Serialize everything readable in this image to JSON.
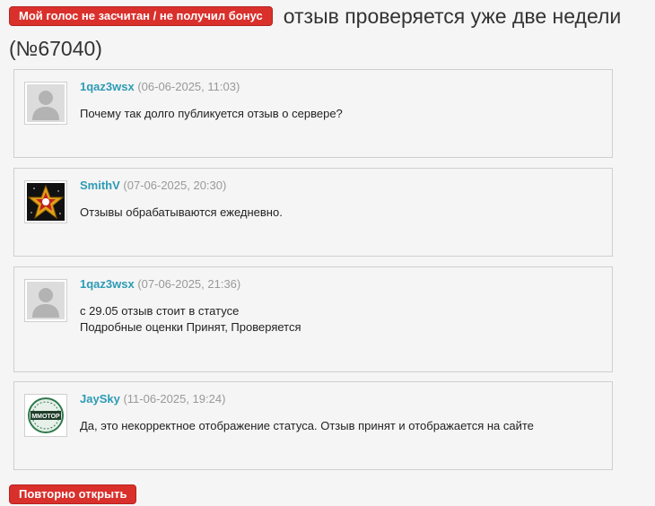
{
  "header": {
    "badge_label": "Мой голос не засчитан / не получил бонус",
    "title": "отзыв проверяется уже две недели (№67040)"
  },
  "messages": [
    {
      "author": "1qaz3wsx",
      "date": "(06-06-2025, 11:03)",
      "avatar_icon": "default-user-avatar-icon",
      "lines": [
        "Почему так долго публикуется отзыв о сервере?"
      ]
    },
    {
      "author": "SmithV",
      "date": "(07-06-2025, 20:30)",
      "avatar_icon": "gold-star-avatar-icon",
      "lines": [
        "Отзывы обрабатываются ежедневно."
      ]
    },
    {
      "author": "1qaz3wsx",
      "date": "(07-06-2025, 21:36)",
      "avatar_icon": "default-user-avatar-icon",
      "lines": [
        "с 29.05 отзыв стоит в статусе",
        "Подробные оценки Принят, Проверяется"
      ]
    },
    {
      "author": "JaySky",
      "date": "(11-06-2025, 19:24)",
      "avatar_icon": "mmotop-logo-avatar-icon",
      "avatar_text": "MMOTOP",
      "lines": [
        "Да, это некорректное отображение статуса. Отзыв принят и отображается на сайте"
      ]
    }
  ],
  "actions": {
    "reopen_label": "Повторно открыть"
  },
  "colors": {
    "accent_red": "#d9302c",
    "author_link": "#2d9bb6",
    "date_gray": "#999999",
    "border": "#cfcfcf"
  }
}
